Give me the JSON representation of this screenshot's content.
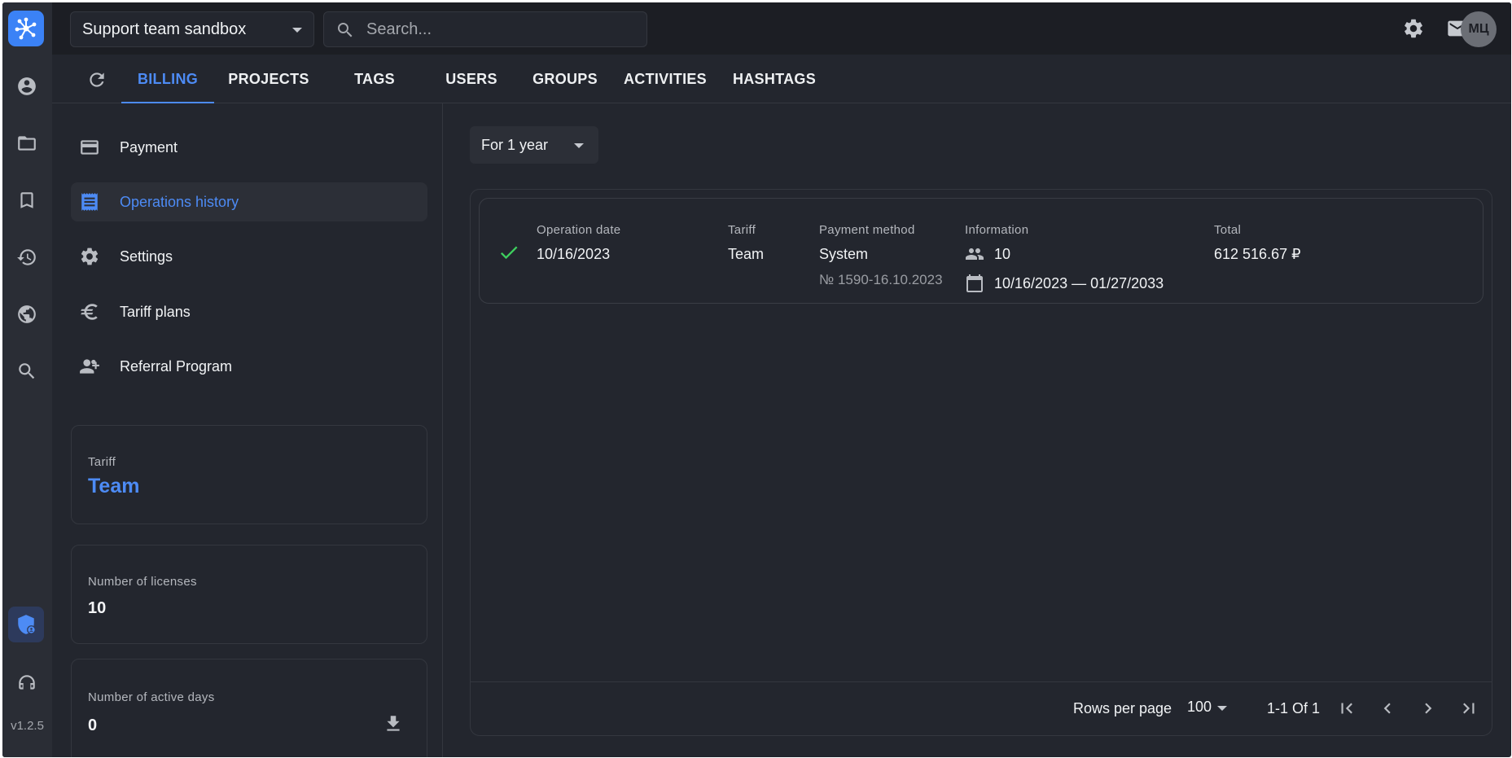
{
  "workspace": {
    "name": "Support team sandbox"
  },
  "search": {
    "placeholder": "Search..."
  },
  "user": {
    "initials": "МЦ"
  },
  "app": {
    "version": "v1.2.5"
  },
  "tabs": [
    {
      "label": "BILLING",
      "active": true
    },
    {
      "label": "PROJECTS"
    },
    {
      "label": "TAGS"
    },
    {
      "label": "USERS"
    },
    {
      "label": "GROUPS"
    },
    {
      "label": "ACTIVITIES"
    },
    {
      "label": "HASHTAGS"
    }
  ],
  "billing_nav": [
    {
      "label": "Payment",
      "icon": "credit-card-icon"
    },
    {
      "label": "Operations history",
      "icon": "receipt-icon",
      "active": true
    },
    {
      "label": "Settings",
      "icon": "gear-icon"
    },
    {
      "label": "Tariff plans",
      "icon": "euro-icon"
    },
    {
      "label": "Referral Program",
      "icon": "person-add-icon"
    }
  ],
  "summary": {
    "tariff_caption": "Tariff",
    "tariff_value": "Team",
    "licenses_caption": "Number of licenses",
    "licenses_value": "10",
    "active_days_caption": "Number of active days",
    "active_days_value": "0"
  },
  "filter": {
    "period": "For 1 year"
  },
  "table": {
    "headers": {
      "date": "Operation date",
      "tariff": "Tariff",
      "method": "Payment method",
      "info": "Information",
      "total": "Total"
    },
    "rows": [
      {
        "status": "success",
        "date": "10/16/2023",
        "tariff": "Team",
        "method": "System",
        "method_ref": "№ 1590-16.10.2023",
        "users": "10",
        "period": "10/16/2023 — 01/27/2033",
        "total": "612 516.67 ₽"
      }
    ],
    "footer": {
      "rows_per_page_label": "Rows per page",
      "rows_per_page": "100",
      "range": "1-1 Of 1"
    }
  },
  "colors": {
    "accent": "#4d8bf5",
    "success": "#3ecf5e",
    "background": "#23262e"
  }
}
